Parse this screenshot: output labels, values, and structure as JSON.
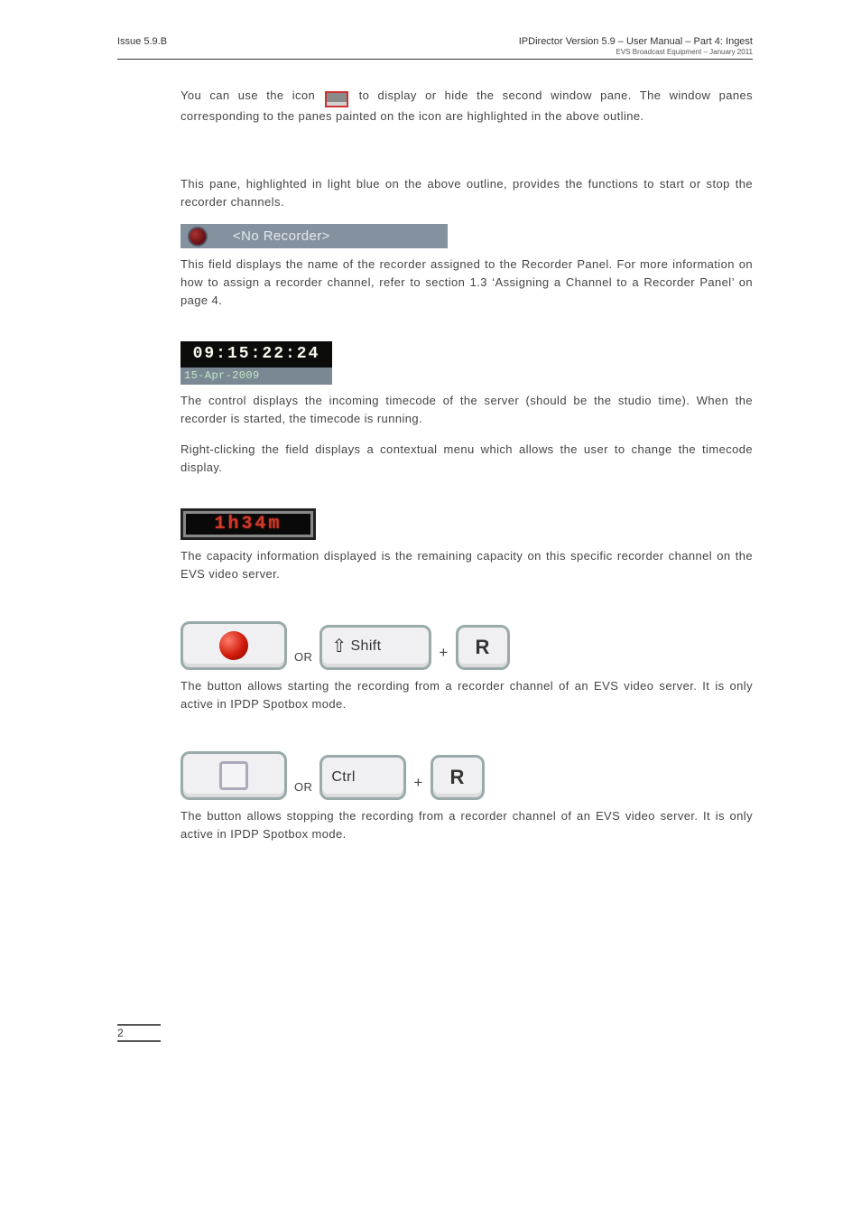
{
  "header": {
    "left": "Issue 5.9.B",
    "right_main": "IPDirector Version 5.9 – User Manual – Part 4: Ingest",
    "right_sub": "EVS Broadcast Equipment – January 2011"
  },
  "intro": {
    "p1a": "You can use the ",
    "p1b": " icon ",
    "p1c": " to display or hide the second window pane. The window panes corresponding to the panes painted on the icon are highlighted in the above outline."
  },
  "recorder_pane": {
    "desc": "This pane, highlighted in light blue on the above outline, provides the functions to start or stop the recorder channels.",
    "no_recorder_label": "<No Recorder>",
    "name_desc": "This field displays the name of the recorder assigned to the Recorder Panel. For more information on how to assign a recorder channel, refer to section 1.3 ‘Assigning a Channel to a Recorder Panel’ on page 4."
  },
  "timecode": {
    "value": "09:15:22:24",
    "date": "15-Apr-2009",
    "desc1": "The control displays the incoming timecode of the server (should be the studio time). When the recorder is started, the timecode is running.",
    "desc2a": "Right-clicking the ",
    "desc2b": " field displays a contextual menu which allows the user to change the timecode display."
  },
  "capacity": {
    "value": "1h34m",
    "desc": "The capacity information displayed is the remaining capacity on this specific recorder channel on the EVS video server."
  },
  "record": {
    "or": "OR",
    "plus": "+",
    "shift": "Shift",
    "key_r": "R",
    "desc": "The   button allows starting the recording from a recorder channel of an EVS video server. It is only active in IPDP Spotbox mode."
  },
  "stop": {
    "or": "OR",
    "plus": "+",
    "ctrl": "Ctrl",
    "key_r": "R",
    "desc": "The   button allows stopping the recording from a recorder channel of an EVS video server. It is only active in IPDP Spotbox mode."
  },
  "footer": {
    "page": "2"
  }
}
